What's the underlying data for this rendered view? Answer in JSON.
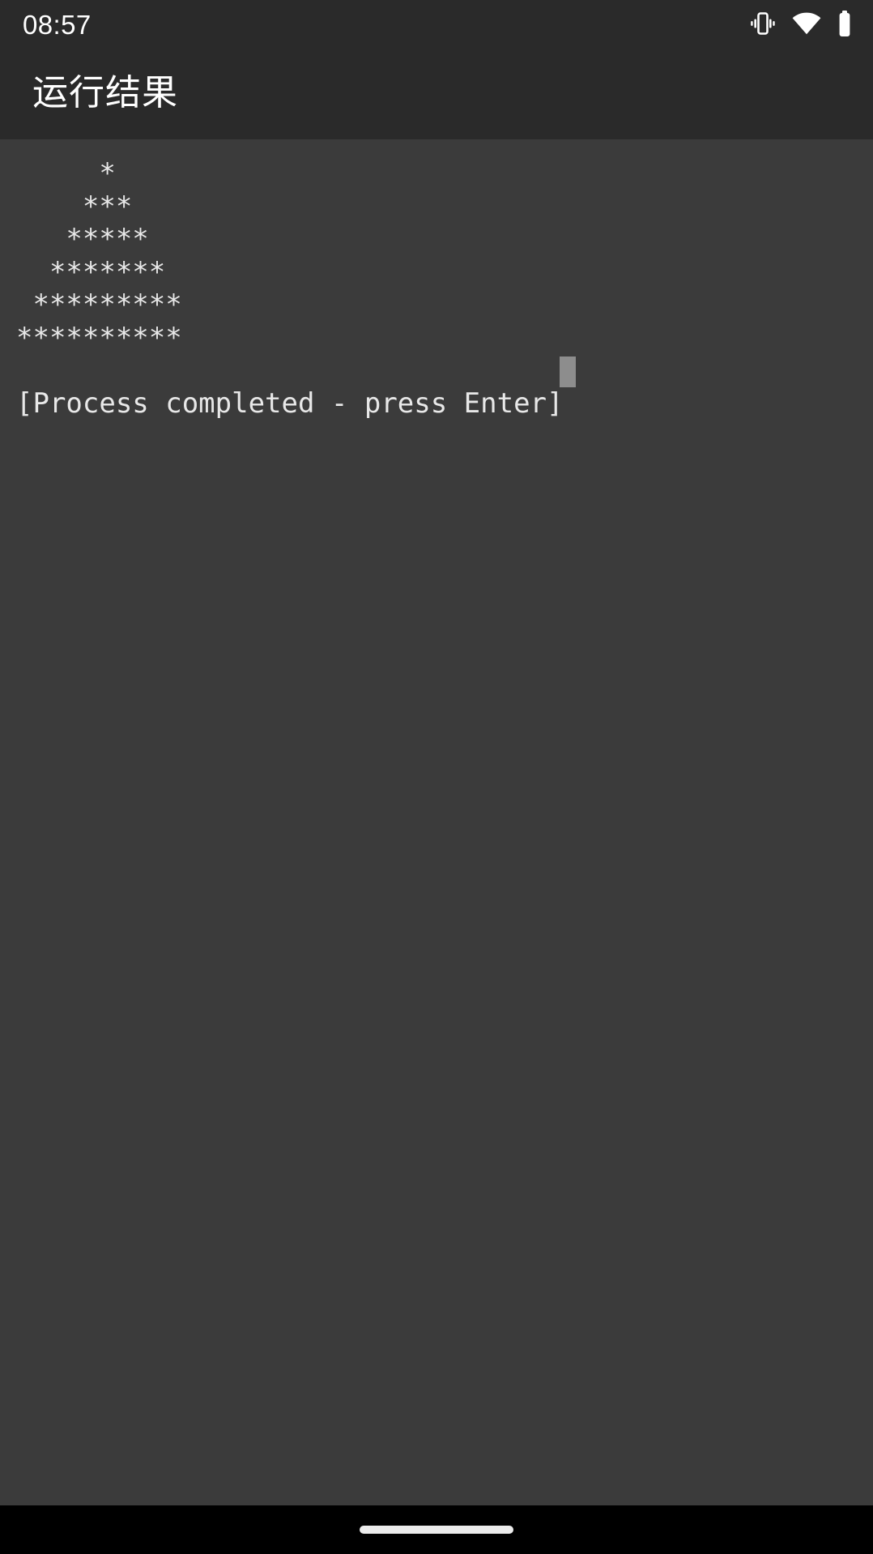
{
  "status_bar": {
    "time": "08:57",
    "icons": [
      {
        "name": "vibrate-icon",
        "label": "vibrate"
      },
      {
        "name": "wifi-icon",
        "label": "wifi"
      },
      {
        "name": "battery-icon",
        "label": "battery"
      }
    ]
  },
  "app_bar": {
    "title": "运行结果"
  },
  "terminal": {
    "output_lines": [
      "     *",
      "    ***",
      "   *****",
      "  *******",
      " *********",
      "**********",
      "",
      "[Process completed - press Enter]"
    ],
    "output_text": "     *\n    ***\n   *****\n  *******\n *********\n**********\n\n[Process completed - press Enter]",
    "star_rows": [
      1,
      3,
      5,
      7,
      9,
      11
    ],
    "status_message": "[Process completed - press Enter]",
    "cursor_visible": true,
    "text_color": "#e8e8e8",
    "background_color": "#3b3b3b"
  },
  "nav_bar": {
    "gesture_pill": "home-gesture-pill"
  },
  "theme": {
    "status_bar_bg": "#2a2a2a",
    "app_bar_bg": "#2a2a2a",
    "terminal_bg": "#3b3b3b",
    "nav_bar_bg": "#000000",
    "accent_text": "#ffffff"
  }
}
